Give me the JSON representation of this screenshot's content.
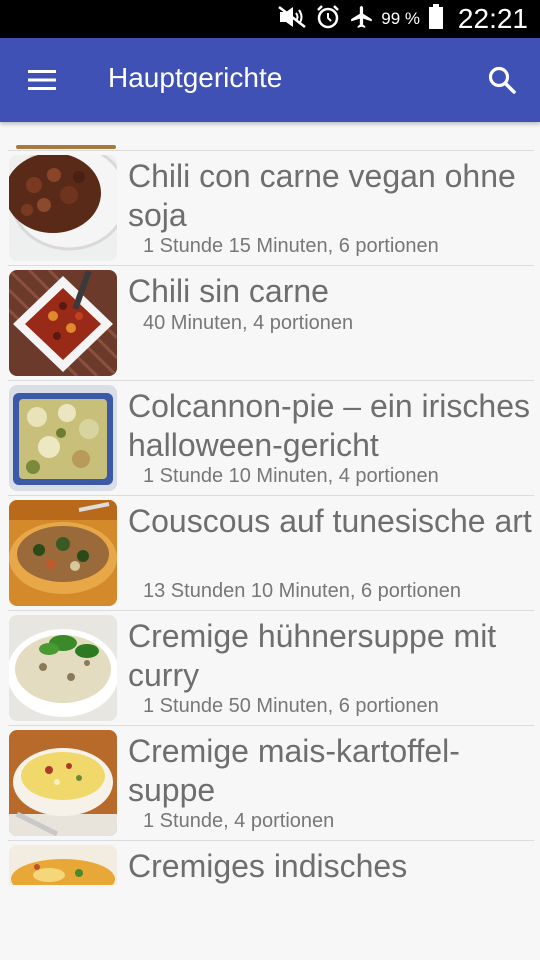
{
  "status_bar": {
    "battery_percent": "99 %",
    "time": "22:21",
    "icons": [
      "mute-icon",
      "alarm-icon",
      "airplane-mode-icon",
      "battery-icon"
    ]
  },
  "app_bar": {
    "title": "Hauptgerichte",
    "menu_icon": "hamburger-menu-icon",
    "search_icon": "search-icon"
  },
  "recipes": [
    {
      "title": "Chili con carne vegan ohne soja",
      "meta": "1 Stunde 15 Minuten, 6 portionen"
    },
    {
      "title": "Chili sin carne",
      "meta": "40 Minuten, 4 portionen"
    },
    {
      "title": "Colcannon-pie – ein irisches halloween-gericht",
      "meta": "1 Stunde 10 Minuten, 4 portionen"
    },
    {
      "title": "Couscous auf tunesische art",
      "meta": "13 Stunden 10 Minuten, 6 portionen"
    },
    {
      "title": "Cremige hühnersuppe mit curry",
      "meta": "1 Stunde 50 Minuten, 6 portionen"
    },
    {
      "title": "Cremige mais-kartoffel-suppe",
      "meta": "1 Stunde, 4 portionen"
    },
    {
      "title": "Cremiges indisches"
    }
  ]
}
